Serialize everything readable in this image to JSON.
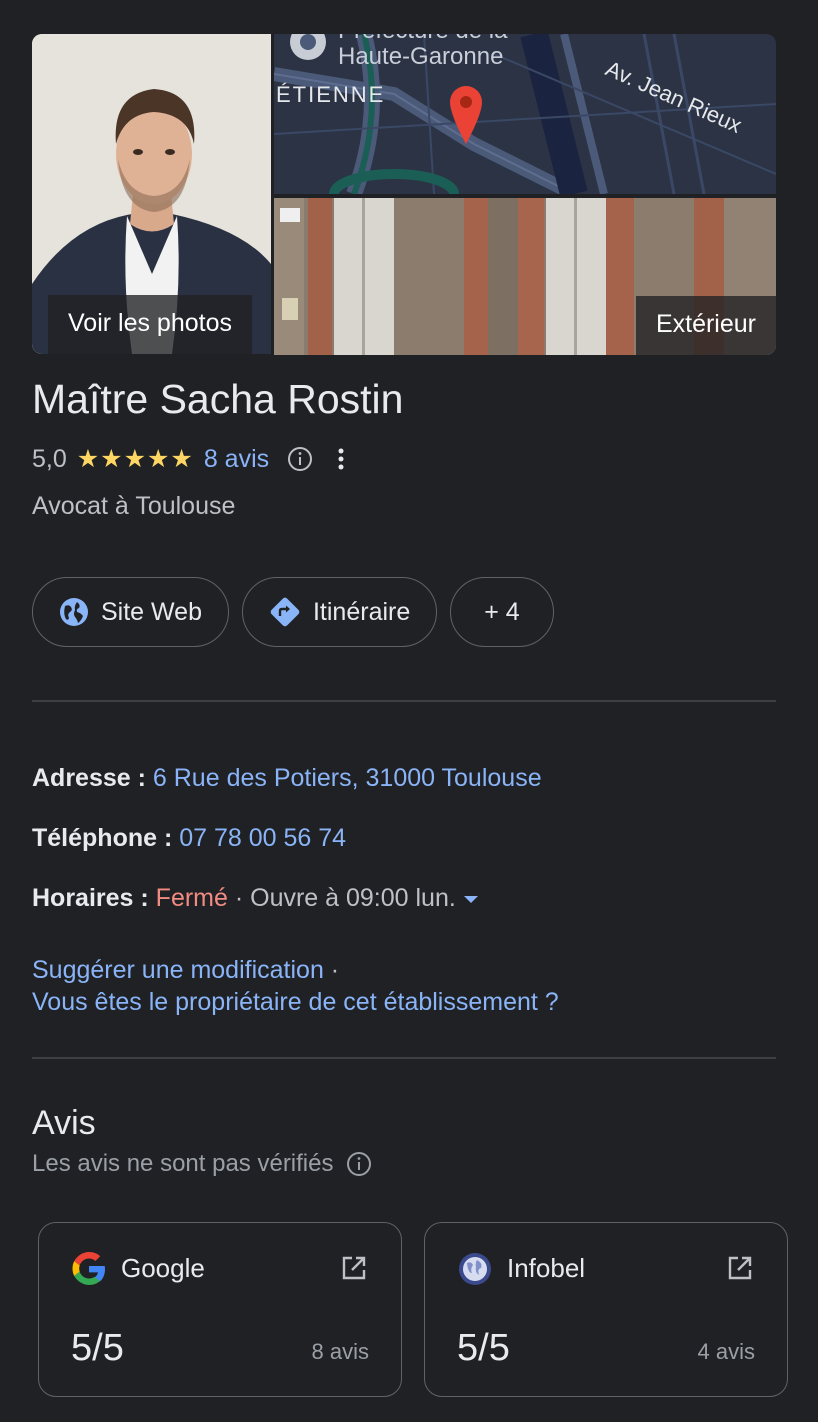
{
  "gallery": {
    "main_label": "Voir les photos",
    "exterior_label": "Extérieur",
    "map_labels": [
      "Préfecture de la",
      "Haute-Garonne",
      "ÉTIENNE",
      "Av. Jean Rieux"
    ]
  },
  "business": {
    "name": "Maître Sacha Rostin",
    "rating": "5,0",
    "stars": "★★★★★",
    "reviews_link": "8 avis",
    "category": "Avocat à Toulouse"
  },
  "actions": {
    "website": "Site Web",
    "directions": "Itinéraire",
    "more": "+ 4"
  },
  "details": {
    "address_label": "Adresse :",
    "address_value": "6 Rue des Potiers, 31000 Toulouse",
    "phone_label": "Téléphone :",
    "phone_value": "07 78 00 56 74",
    "hours_label": "Horaires :",
    "hours_status": "Fermé",
    "hours_sep": " · ",
    "hours_next": "Ouvre à 09:00 lun."
  },
  "links": {
    "suggest": "Suggérer une modification",
    "sep": " ·",
    "owner": "Vous êtes le propriétaire de cet établissement ?"
  },
  "reviews": {
    "title": "Avis",
    "subtitle": "Les avis ne sont pas vérifiés",
    "sources": [
      {
        "name": "Google",
        "score": "5/5",
        "count": "8 avis"
      },
      {
        "name": "Infobel",
        "score": "5/5",
        "count": "4 avis"
      }
    ]
  },
  "colors": {
    "background": "#202124",
    "link": "#8ab4f8",
    "star": "#fdd663",
    "closed": "#f28b82"
  }
}
